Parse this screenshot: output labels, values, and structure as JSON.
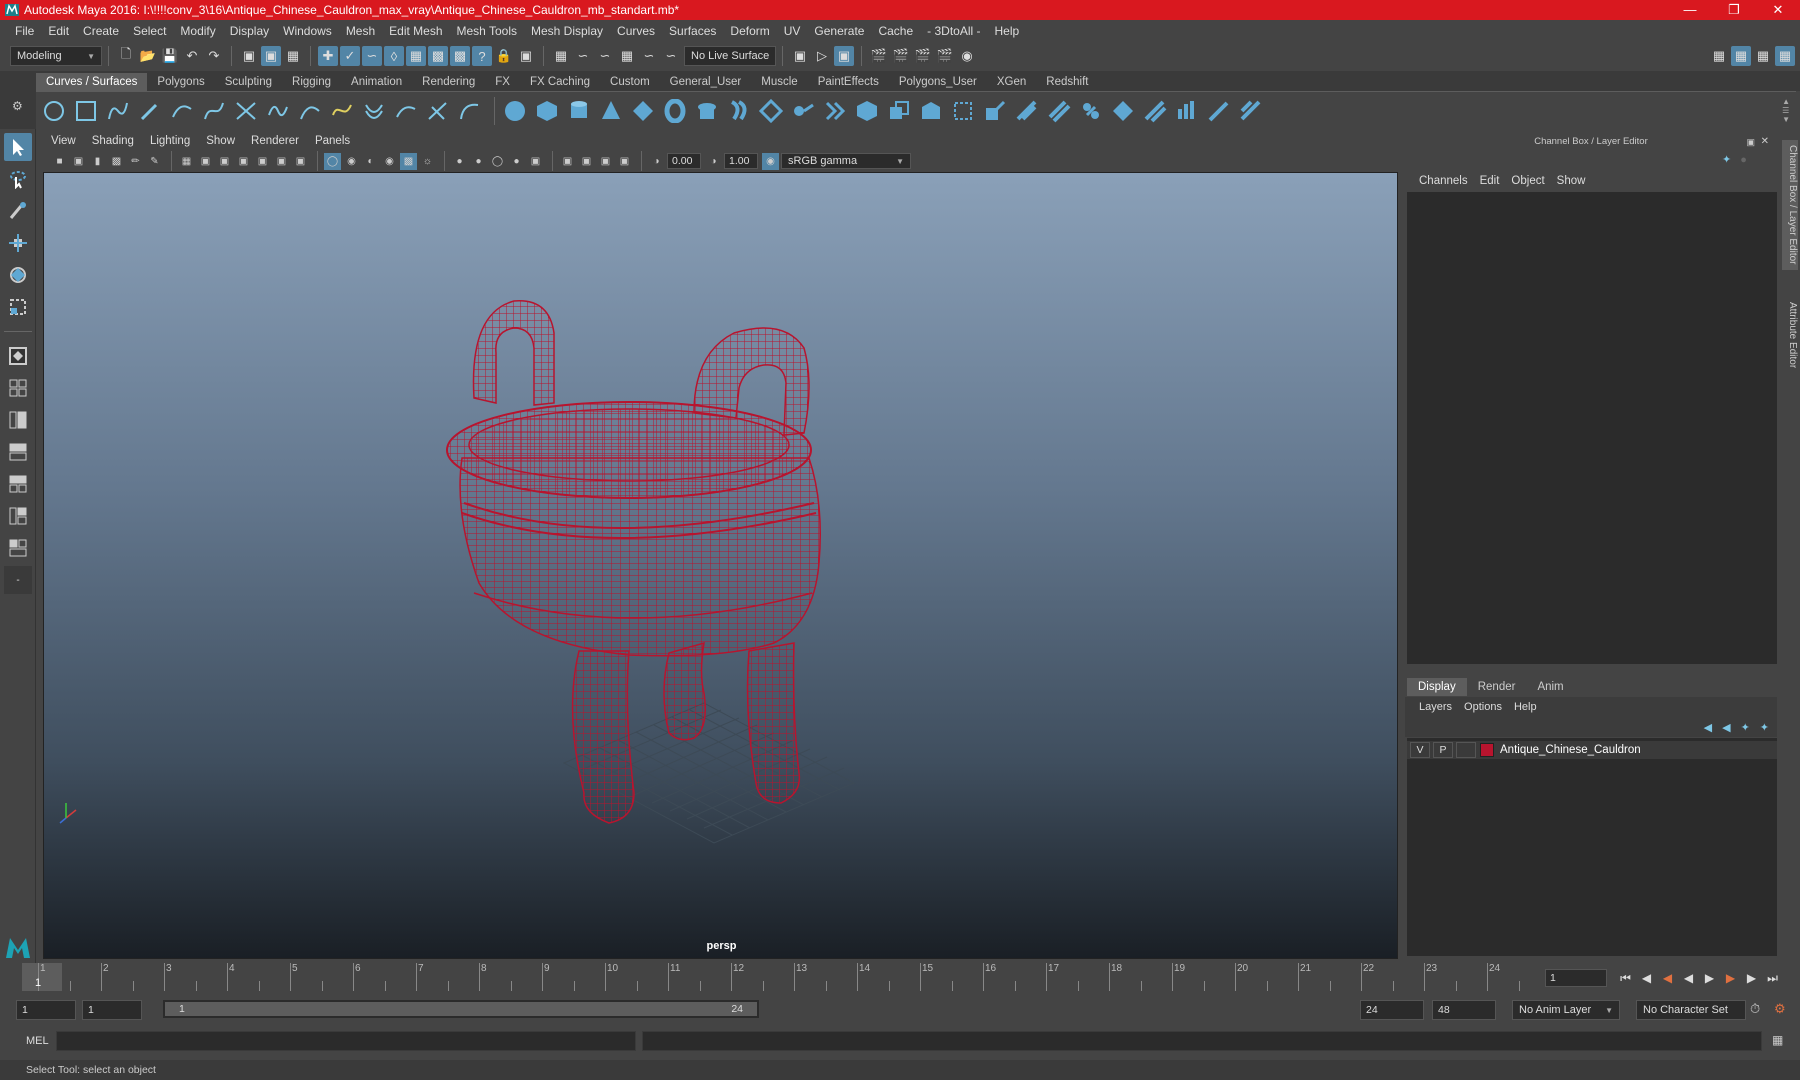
{
  "window": {
    "title": "Autodesk Maya 2016: I:\\!!!!conv_3\\16\\Antique_Chinese_Cauldron_max_vray\\Antique_Chinese_Cauldron_mb_standart.mb*",
    "minimize": "—",
    "maximize": "❐",
    "close": "✕"
  },
  "menu": [
    "File",
    "Edit",
    "Create",
    "Select",
    "Modify",
    "Display",
    "Windows",
    "Mesh",
    "Edit Mesh",
    "Mesh Tools",
    "Mesh Display",
    "Curves",
    "Surfaces",
    "Deform",
    "UV",
    "Generate",
    "Cache",
    "- 3DtoAll -",
    "Help"
  ],
  "status_line": {
    "mode": "Modeling",
    "live_surface": "No Live Surface"
  },
  "shelf": {
    "tabs": [
      "Curves / Surfaces",
      "Polygons",
      "Sculpting",
      "Rigging",
      "Animation",
      "Rendering",
      "FX",
      "FX Caching",
      "Custom",
      "General_User",
      "Muscle",
      "PaintEffects",
      "Polygons_User",
      "XGen",
      "Redshift"
    ],
    "active_tab": "Curves / Surfaces"
  },
  "panel": {
    "menu": [
      "View",
      "Shading",
      "Lighting",
      "Show",
      "Renderer",
      "Panels"
    ],
    "exposure": "0.00",
    "gamma": "1.00",
    "color_space": "sRGB gamma",
    "camera": "persp"
  },
  "channel_box": {
    "header": "Channel Box / Layer Editor",
    "menu": [
      "Channels",
      "Edit",
      "Object",
      "Show"
    ]
  },
  "side_tabs": [
    "Channel Box / Layer Editor",
    "Attribute Editor"
  ],
  "layer_editor": {
    "tabs": [
      "Display",
      "Render",
      "Anim"
    ],
    "active_tab": "Display",
    "menu": [
      "Layers",
      "Options",
      "Help"
    ],
    "layers": [
      {
        "v": "V",
        "p": "P",
        "color": "#b8142e",
        "name": "Antique_Chinese_Cauldron"
      }
    ]
  },
  "timeline": {
    "ticks": [
      "1",
      "2",
      "3",
      "4",
      "5",
      "6",
      "7",
      "8",
      "9",
      "10",
      "11",
      "12",
      "13",
      "14",
      "15",
      "16",
      "17",
      "18",
      "19",
      "20",
      "21",
      "22",
      "23",
      "24"
    ],
    "current_frame_label": "1",
    "current_frame_field": "1"
  },
  "range": {
    "start_field": "1",
    "playback_start": "1",
    "range_start": "1",
    "range_end": "24",
    "playback_end": "24",
    "end_field": "48",
    "anim_layer": "No Anim Layer",
    "character_set": "No Character Set"
  },
  "command_line": {
    "label": "MEL"
  },
  "help_line": "Select Tool: select an object",
  "colors": {
    "wire": "#b8142e",
    "accent": "#5285a6"
  }
}
